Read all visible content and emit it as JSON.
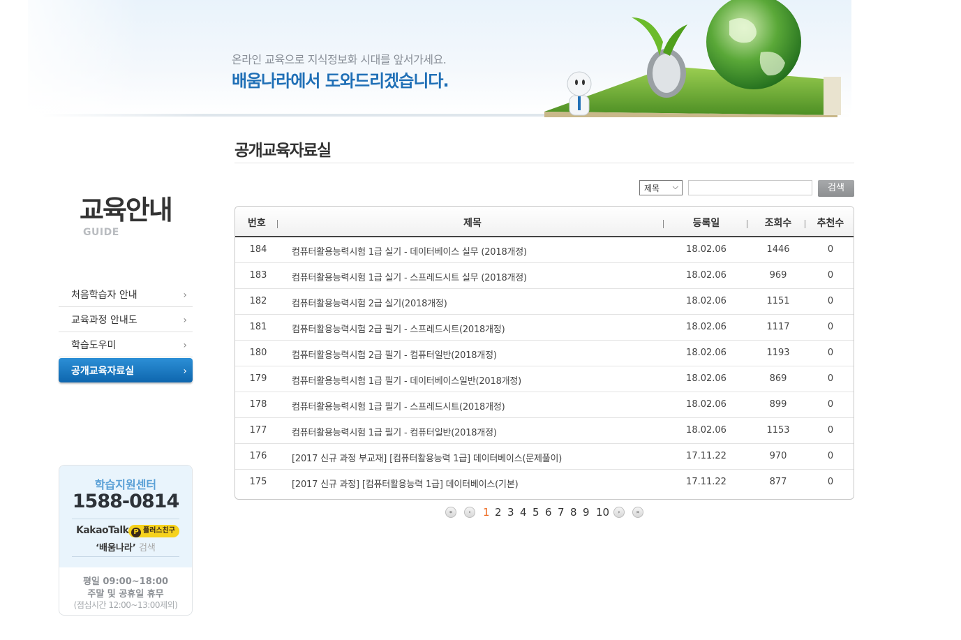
{
  "banner": {
    "tagline_small": "온라인 교육으로 지식정보화 시대를 앞서가세요.",
    "tagline_large": "배움나라에서 도와드리겠습니다."
  },
  "section": {
    "title": "교육안내",
    "subtitle": "GUIDE"
  },
  "nav": {
    "items": [
      {
        "label": "처음학습자 안내"
      },
      {
        "label": "교육과정 안내도"
      },
      {
        "label": "학습도우미"
      },
      {
        "label": "공개교육자료실"
      }
    ],
    "active_index": 3,
    "chevron": "›"
  },
  "support": {
    "title": "학습지원센터",
    "phone": "1588-0814",
    "kakao_label": "KakaoTalk",
    "kakao_badge": "플러스친구",
    "kakao_badge_icon": "P",
    "kakao_search_name": "‘배움나라’",
    "kakao_search_suffix": "검색",
    "hours_weekday": "평일 09:00~18:00",
    "hours_weekend": "주말 및 공휴일 휴무",
    "hours_lunch": "(점심시간 12:00~13:00제외)"
  },
  "page": {
    "title": "공개교육자료실"
  },
  "search": {
    "select_value": "제목",
    "select_caret": "⌵",
    "input_value": "",
    "button_label": "검색"
  },
  "table": {
    "headers": {
      "no": "번호",
      "title": "제목",
      "date": "등록일",
      "views": "조회수",
      "recommend": "추천수"
    },
    "rows": [
      {
        "no": "184",
        "title": "컴퓨터활용능력시험 1급 실기 - 데이터베이스 실무 (2018개정)",
        "date": "18.02.06",
        "views": "1446",
        "recommend": "0"
      },
      {
        "no": "183",
        "title": "컴퓨터활용능력시험 1급 실기 - 스프레드시트 실무 (2018개정)",
        "date": "18.02.06",
        "views": "969",
        "recommend": "0"
      },
      {
        "no": "182",
        "title": "컴퓨터활용능력시험 2급 실기(2018개정)",
        "date": "18.02.06",
        "views": "1151",
        "recommend": "0"
      },
      {
        "no": "181",
        "title": "컴퓨터활용능력시험 2급 필기 - 스프레드시트(2018개정)",
        "date": "18.02.06",
        "views": "1117",
        "recommend": "0"
      },
      {
        "no": "180",
        "title": "컴퓨터활용능력시험 2급 필기 - 컴퓨터일반(2018개정)",
        "date": "18.02.06",
        "views": "1193",
        "recommend": "0"
      },
      {
        "no": "179",
        "title": "컴퓨터활용능력시험 1급 필기 - 데이터베이스일반(2018개정)",
        "date": "18.02.06",
        "views": "869",
        "recommend": "0"
      },
      {
        "no": "178",
        "title": "컴퓨터활용능력시험 1급 필기 - 스프레드시트(2018개정)",
        "date": "18.02.06",
        "views": "899",
        "recommend": "0"
      },
      {
        "no": "177",
        "title": "컴퓨터활용능력시험 1급 필기 - 컴퓨터일반(2018개정)",
        "date": "18.02.06",
        "views": "1153",
        "recommend": "0"
      },
      {
        "no": "176",
        "title": "[2017 신규 과정 부교재] [컴퓨터활용능력 1급] 데이터베이스(문제풀이)",
        "date": "17.11.22",
        "views": "970",
        "recommend": "0"
      },
      {
        "no": "175",
        "title": "[2017 신규 과정] [컴퓨터활용능력 1급] 데이터베이스(기본)",
        "date": "17.11.22",
        "views": "877",
        "recommend": "0"
      }
    ]
  },
  "pagination": {
    "first_icon": "«",
    "prev_icon": "‹",
    "next_icon": "›",
    "last_icon": "»",
    "pages": [
      "1",
      "2",
      "3",
      "4",
      "5",
      "6",
      "7",
      "8",
      "9",
      "10"
    ],
    "current": "1"
  },
  "colors": {
    "accent": "#1f6fb6",
    "nav_active": "#1477c2",
    "current_page": "#ee6a1f"
  }
}
